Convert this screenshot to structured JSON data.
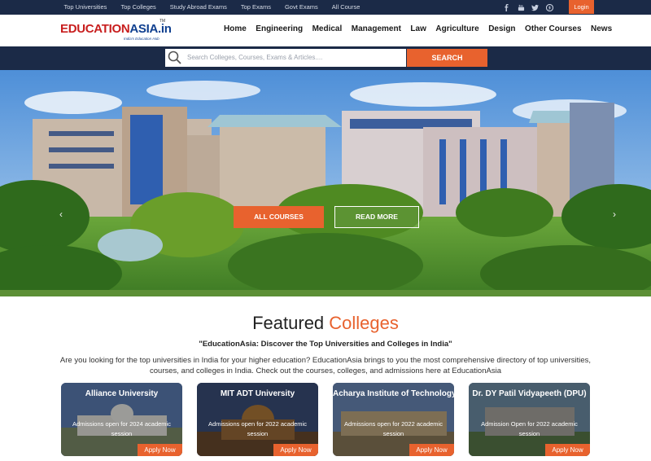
{
  "topbar": {
    "links": [
      "Top Universities",
      "Top Colleges",
      "Study Abroad Exams",
      "Top Exams",
      "Govt Exams",
      "All Course"
    ],
    "social_icons": [
      "facebook-icon",
      "youtube-icon",
      "twitter-icon",
      "pinterest-icon"
    ],
    "login_label": "Login"
  },
  "header": {
    "logo": {
      "brand_red": "EDUCATION",
      "brand_blue": "ASIA.in",
      "tagline": "India's Education Hub",
      "tm": "TM"
    },
    "nav": [
      "Home",
      "Engineering",
      "Medical",
      "Management",
      "Law",
      "Agriculture",
      "Design",
      "Other Courses",
      "News"
    ]
  },
  "search": {
    "placeholder": "Search Colleges, Courses, Exams & Articles....",
    "button_label": "SEARCH"
  },
  "hero": {
    "btn_all_courses": "ALL COURSES",
    "btn_read_more": "READ MORE",
    "prev_arrow": "‹",
    "next_arrow": "›"
  },
  "featured": {
    "title_main": "Featured ",
    "title_accent": "Colleges",
    "subtitle": "\"EducationAsia: Discover the Top Universities and Colleges in India\"",
    "description": "Are you looking for the top universities in India for your higher education? EducationAsia brings to you the most comprehensive directory of top universities, courses, and colleges in India. Check out the courses, colleges, and admissions here at EducationAsia",
    "cards": [
      {
        "name": "Alliance University",
        "note": "Admissions open for 2024 academic session",
        "apply": "Apply Now"
      },
      {
        "name": "MIT ADT University",
        "note": "Admissions open for 2022 academic session",
        "apply": "Apply Now"
      },
      {
        "name": "Acharya Institute of Technology",
        "note": "Admissions open for 2022 academic session",
        "apply": "Apply Now"
      },
      {
        "name": "Dr. DY Patil Vidyapeeth (DPU)",
        "note": "Admission Open for 2022 academic session",
        "apply": "Apply Now"
      }
    ]
  },
  "colors": {
    "navy": "#1b2a47",
    "accent": "#e8622e",
    "logo_red": "#c81e1e",
    "logo_blue": "#0f3f8f"
  }
}
